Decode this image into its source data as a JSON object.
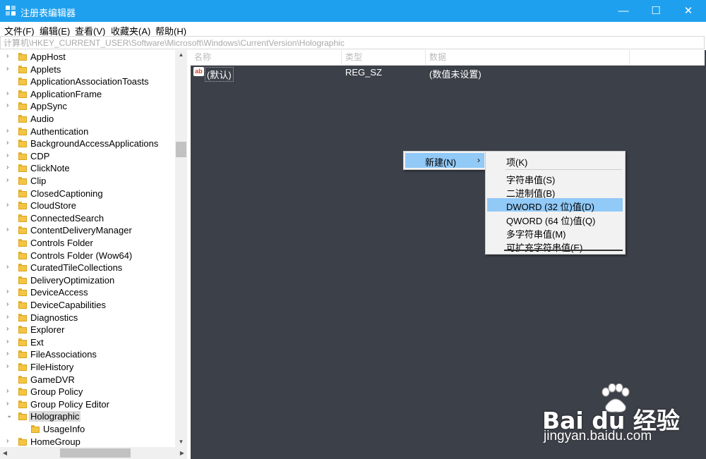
{
  "window": {
    "title": "注册表编辑器",
    "accent_color": "#1fa0ee",
    "controls": {
      "minimize": "—",
      "maximize": "☐",
      "close": "✕"
    }
  },
  "menubar": {
    "items": [
      "文件(F)",
      "编辑(E)",
      "查看(V)",
      "收藏夹(A)",
      "帮助(H)"
    ]
  },
  "address": {
    "path": "计算机\\HKEY_CURRENT_USER\\Software\\Microsoft\\Windows\\CurrentVersion\\Holographic"
  },
  "tree": {
    "items": [
      {
        "label": "AppHost",
        "expandable": true
      },
      {
        "label": "Applets",
        "expandable": true
      },
      {
        "label": "ApplicationAssociationToasts",
        "expandable": false
      },
      {
        "label": "ApplicationFrame",
        "expandable": true
      },
      {
        "label": "AppSync",
        "expandable": true
      },
      {
        "label": "Audio",
        "expandable": false
      },
      {
        "label": "Authentication",
        "expandable": true
      },
      {
        "label": "BackgroundAccessApplications",
        "expandable": true
      },
      {
        "label": "CDP",
        "expandable": true
      },
      {
        "label": "ClickNote",
        "expandable": true
      },
      {
        "label": "Clip",
        "expandable": true
      },
      {
        "label": "ClosedCaptioning",
        "expandable": false
      },
      {
        "label": "CloudStore",
        "expandable": true
      },
      {
        "label": "ConnectedSearch",
        "expandable": false
      },
      {
        "label": "ContentDeliveryManager",
        "expandable": true
      },
      {
        "label": "Controls Folder",
        "expandable": false
      },
      {
        "label": "Controls Folder (Wow64)",
        "expandable": false
      },
      {
        "label": "CuratedTileCollections",
        "expandable": true
      },
      {
        "label": "DeliveryOptimization",
        "expandable": false
      },
      {
        "label": "DeviceAccess",
        "expandable": true
      },
      {
        "label": "DeviceCapabilities",
        "expandable": true
      },
      {
        "label": "Diagnostics",
        "expandable": true
      },
      {
        "label": "Explorer",
        "expandable": true
      },
      {
        "label": "Ext",
        "expandable": true
      },
      {
        "label": "FileAssociations",
        "expandable": true
      },
      {
        "label": "FileHistory",
        "expandable": true
      },
      {
        "label": "GameDVR",
        "expandable": false
      },
      {
        "label": "Group Policy",
        "expandable": true
      },
      {
        "label": "Group Policy Editor",
        "expandable": true
      },
      {
        "label": "Holographic",
        "expandable": true,
        "expanded": true,
        "selected": true
      },
      {
        "label": "UsageInfo",
        "expandable": false,
        "child": true
      },
      {
        "label": "HomeGroup",
        "expandable": true
      }
    ]
  },
  "list": {
    "columns": [
      "名称",
      "类型",
      "数据"
    ],
    "rows": [
      {
        "name": "(默认)",
        "type": "REG_SZ",
        "data": "(数值未设置)"
      }
    ]
  },
  "context_menu": {
    "new_label": "新建(N)",
    "submenu": [
      {
        "label": "项(K)"
      },
      {
        "label": "字符串值(S)"
      },
      {
        "label": "二进制值(B)"
      },
      {
        "label": "DWORD (32 位)值(D)",
        "highlighted": true
      },
      {
        "label": "QWORD (64 位)值(Q)"
      },
      {
        "label": "多字符串值(M)"
      },
      {
        "label": "可扩充字符串值(E)"
      }
    ]
  },
  "watermark": {
    "brand": "Bai du 经验",
    "url": "jingyan.baidu.com"
  }
}
